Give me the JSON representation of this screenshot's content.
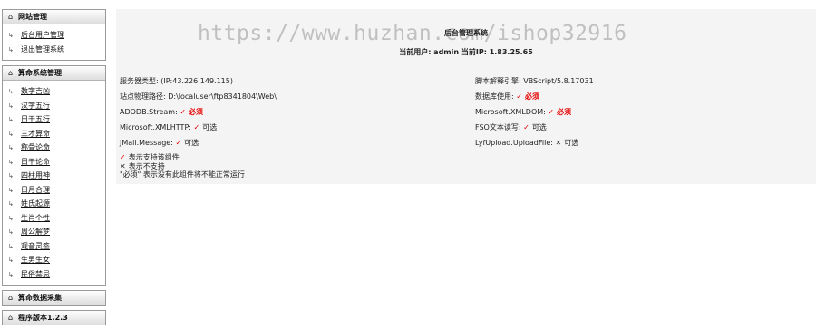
{
  "sidebar": {
    "site_manage": {
      "title": "网站管理",
      "items": [
        "后台用户管理",
        "退出管理系统"
      ]
    },
    "fortune_manage": {
      "title": "算命系统管理",
      "items": [
        "数字吉凶",
        "汉字五行",
        "日干五行",
        "三才算命",
        "称骨论命",
        "日干论命",
        "四柱用神",
        "日月合理",
        "姓氏起源",
        "生肖个性",
        "周公解梦",
        "观音灵签",
        "生男生女",
        "民俗禁忌"
      ]
    },
    "data_collect": {
      "title": "算命数据采集"
    },
    "version": {
      "title": "程序版本1.2.3"
    }
  },
  "main": {
    "watermark": "https://www.huzhan.com/ishop32916",
    "title": "后台管理系统",
    "user_line": "当前用户: admin 当前IP: 1.83.25.65",
    "rows": {
      "server_type": "服务器类型: (IP:43.226.149.115)",
      "script_engine": "脚本解释引擎: VBScript/5.8.17031",
      "site_path": "站点物理路径: D:\\localuser\\ftp8341804\\Web\\",
      "db_use_label": "数据库使用:",
      "db_use_status": "必须",
      "adodb_label": "ADODB.Stream:",
      "adodb_status": "必须",
      "xmldom_label": "Microsoft.XMLDOM:",
      "xmldom_status": "必须",
      "xmlhttp_label": "Microsoft.XMLHTTP:",
      "xmlhttp_status": "可选",
      "fso_label": "FSO文本读写:",
      "fso_status": "可选",
      "jmail_label": "JMail.Message:",
      "jmail_status": "可选",
      "lyf_label": "LyfUpload.UploadFile:",
      "lyf_status": "可选"
    },
    "legend": {
      "supported": "表示支持该组件",
      "unsupported": "表示不支持",
      "required_note": "\"必须\" 表示没有此组件将不能正常运行"
    }
  }
}
